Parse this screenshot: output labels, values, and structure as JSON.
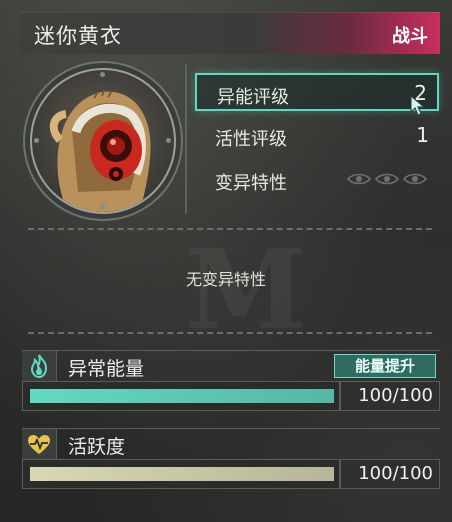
{
  "header": {
    "title": "迷你黄衣",
    "tag": "战斗"
  },
  "avatar": {
    "icon": "character-portrait-icon"
  },
  "stats": [
    {
      "label": "异能评级",
      "value": "2",
      "active": true
    },
    {
      "label": "活性评级",
      "value": "1",
      "active": false
    },
    {
      "label": "变异特性",
      "value": "",
      "icon": "eyes-icon",
      "active": false
    }
  ],
  "mutation_note": "无变异特性",
  "energy": {
    "title": "异常能量",
    "button": "能量提升",
    "value_text": "100/100",
    "current": 100,
    "max": 100,
    "color": "#63d9c2",
    "icon": "flame-icon"
  },
  "activity": {
    "title": "活跃度",
    "value_text": "100/100",
    "current": 100,
    "max": 100,
    "color": "#d9d8b4",
    "icon": "heart-pulse-icon"
  },
  "colors": {
    "accent": "#5fd7c2",
    "header_tag_bg": "#c82e5e"
  }
}
